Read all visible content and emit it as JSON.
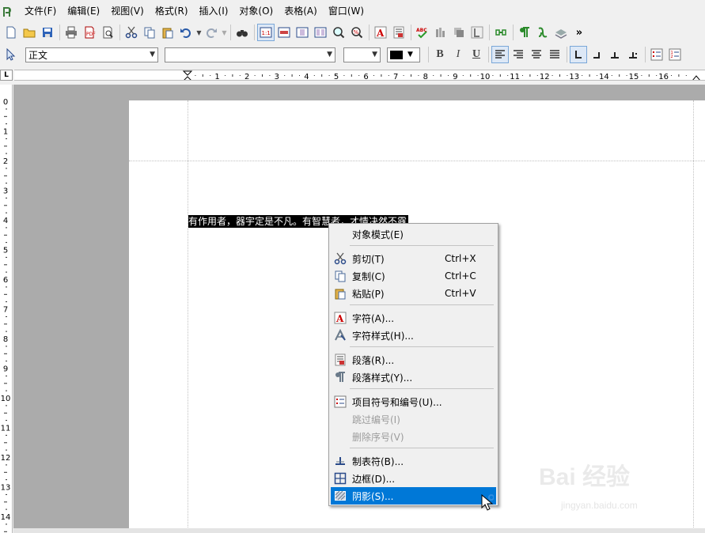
{
  "menubar": {
    "items": [
      "文件(F)",
      "编辑(E)",
      "视图(V)",
      "格式(R)",
      "插入(I)",
      "对象(O)",
      "表格(A)",
      "窗口(W)"
    ]
  },
  "toolbar": {
    "overflow_label": "»"
  },
  "format_bar": {
    "paragraph_style": "正文",
    "font_name": "",
    "font_size": "",
    "font_color": "#000000"
  },
  "ruler": {
    "h_numbers": [
      "1",
      "2",
      "3",
      "4",
      "5",
      "6",
      "7",
      "8",
      "9",
      "10",
      "11",
      "12",
      "13",
      "14",
      "15",
      "16"
    ],
    "v_numbers": [
      "0",
      "1",
      "2",
      "3",
      "4",
      "5",
      "6",
      "7",
      "8",
      "9",
      "10",
      "11",
      "12",
      "13",
      "14"
    ],
    "corner_label": "L"
  },
  "document": {
    "selected_text": "有作用者，器宇定是不凡。有智慧者，才情决然不露"
  },
  "context_menu": {
    "object_mode": "对象模式(E)",
    "cut": "剪切(T)",
    "cut_shortcut": "Ctrl+X",
    "copy": "复制(C)",
    "copy_shortcut": "Ctrl+C",
    "paste": "粘贴(P)",
    "paste_shortcut": "Ctrl+V",
    "character": "字符(A)...",
    "character_style": "字符样式(H)...",
    "paragraph": "段落(R)...",
    "paragraph_style": "段落样式(Y)...",
    "bullets_numbering": "项目符号和编号(U)...",
    "skip_numbering": "跳过编号(I)",
    "delete_numbering": "删除序号(V)",
    "tabs": "制表符(B)...",
    "borders": "边框(D)...",
    "shading": "阴影(S)..."
  },
  "watermark": {
    "brand": "Bai 经验",
    "url": "jingyan.baidu.com"
  },
  "colors": {
    "highlight": "#0078d7",
    "selection_bg": "#000000",
    "workspace": "#ababab"
  }
}
